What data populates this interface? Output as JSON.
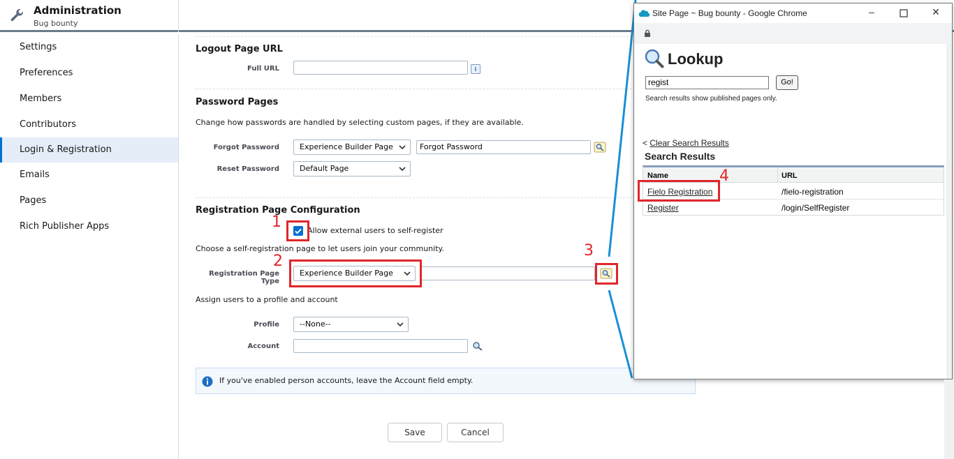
{
  "header": {
    "title": "Administration",
    "subtitle": "Bug bounty"
  },
  "sidebar": {
    "items": [
      {
        "label": "Settings"
      },
      {
        "label": "Preferences"
      },
      {
        "label": "Members"
      },
      {
        "label": "Contributors"
      },
      {
        "label": "Login & Registration",
        "active": true
      },
      {
        "label": "Emails"
      },
      {
        "label": "Pages"
      },
      {
        "label": "Rich Publisher Apps"
      }
    ]
  },
  "logout": {
    "title": "Logout Page URL",
    "full_url_label": "Full URL",
    "full_url_value": ""
  },
  "password": {
    "title": "Password Pages",
    "description": "Change how passwords are handled by selecting custom pages, if they are available.",
    "forgot_label": "Forgot Password",
    "forgot_type": "Experience Builder Page",
    "forgot_value": "Forgot Password",
    "reset_label": "Reset Password",
    "reset_type": "Default Page"
  },
  "registration": {
    "title": "Registration Page Configuration",
    "allow_label": "Allow external users to self-register",
    "allow_checked": true,
    "choose_text": "Choose a self-registration page to let users join your community.",
    "type_label": "Registration Page Type",
    "type_value": "Experience Builder Page",
    "page_value": "",
    "assign_text": "Assign users to a profile and account",
    "profile_label": "Profile",
    "profile_value": "--None--",
    "account_label": "Account",
    "account_value": "",
    "info_text": "If you've enabled person accounts, leave the Account field empty."
  },
  "actions": {
    "save": "Save",
    "cancel": "Cancel"
  },
  "annotations": {
    "n1": "1",
    "n2": "2",
    "n3": "3",
    "n4": "4"
  },
  "popup": {
    "window_title": "Site Page ~ Bug bounty - Google Chrome",
    "heading": "Lookup",
    "search_value": "regist",
    "go_label": "Go!",
    "note": "Search results show published pages only.",
    "clear_prefix": "<",
    "clear_link": "Clear Search Results",
    "results_title": "Search Results",
    "columns": [
      "Name",
      "URL"
    ],
    "rows": [
      {
        "name": "Fielo Registration",
        "url": "/fielo-registration"
      },
      {
        "name": "Register",
        "url": "/login/SelfRegister"
      }
    ]
  },
  "colors": {
    "accent": "#0070d2",
    "annotation_red": "#e0262b",
    "annotation_line": "#1a8fd6"
  }
}
